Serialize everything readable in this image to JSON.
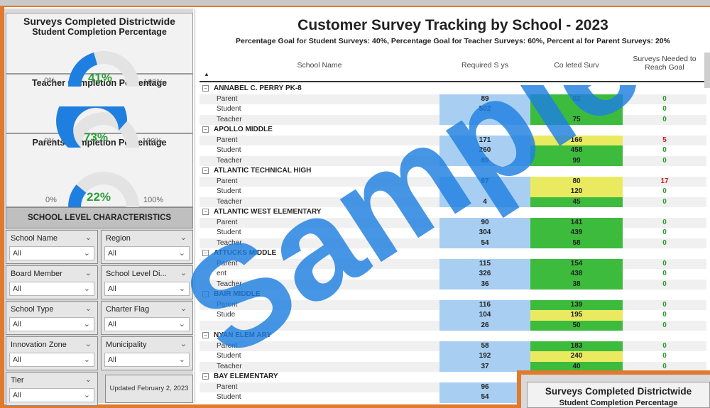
{
  "left_panel": {
    "title": "Surveys Completed Districtwide",
    "gauges": [
      {
        "label": "Student Completion Percentage",
        "value": 0.41,
        "pct_text": "41%",
        "min": "0%",
        "max": "100%"
      },
      {
        "label": "Teacher Completion Percentage",
        "value": 0.73,
        "pct_text": "73%",
        "min": "0%",
        "max": "100%"
      },
      {
        "label": "Parents Completion Percentage",
        "value": 0.22,
        "pct_text": "22%",
        "min": "0%",
        "max": "100%"
      }
    ],
    "section_header": "SCHOOL LEVEL CHARACTERISTICS",
    "filters": [
      {
        "label": "School Name",
        "value": "All"
      },
      {
        "label": "Region",
        "value": "All"
      },
      {
        "label": "Board Member",
        "value": "All"
      },
      {
        "label": "School Level Di...",
        "value": "All"
      },
      {
        "label": "School Type",
        "value": "All"
      },
      {
        "label": "Charter Flag",
        "value": "All"
      },
      {
        "label": "Innovation Zone",
        "value": "All"
      },
      {
        "label": "Municipality",
        "value": "All"
      },
      {
        "label": "Tier",
        "value": "All"
      }
    ],
    "updated": "Updated February 2, 2023"
  },
  "main": {
    "title": "Customer Survey Tracking by School - 2023",
    "subtitle": "Percentage Goal for Student Surveys: 40%, Percentage Goal for Teacher Surveys: 60%, Percent    al for Parent Surveys: 20%",
    "columns": [
      "School Name",
      "Required S      ys",
      "Co   leted Surv",
      "Surveys Needed to Reach Goal"
    ],
    "rows": [
      {
        "type": "group",
        "name": "ANNABEL C. PERRY PK-8"
      },
      {
        "type": "sub",
        "name": "Parent",
        "req": "89",
        "comp": "02",
        "comp_color": "green",
        "need": "0",
        "need_color": "g"
      },
      {
        "type": "sub",
        "name": "Student",
        "req": "502",
        "comp": "",
        "comp_color": "green",
        "need": "0",
        "need_color": "g"
      },
      {
        "type": "sub",
        "name": "Teacher",
        "req": "",
        "comp": "75",
        "comp_color": "green",
        "need": "0",
        "need_color": "g"
      },
      {
        "type": "group",
        "name": "APOLLO MIDDLE"
      },
      {
        "type": "sub",
        "name": "Parent",
        "req": "171",
        "comp": "166",
        "comp_color": "yellow",
        "need": "5",
        "need_color": "r"
      },
      {
        "type": "sub",
        "name": "Student",
        "req": "260",
        "comp": "458",
        "comp_color": "green",
        "need": "0",
        "need_color": "g"
      },
      {
        "type": "sub",
        "name": "Teacher",
        "req": "89",
        "comp": "99",
        "comp_color": "green",
        "need": "0",
        "need_color": "g"
      },
      {
        "type": "group",
        "name": "ATLANTIC TECHNICAL HIGH"
      },
      {
        "type": "sub",
        "name": "Parent",
        "req": "97",
        "comp": "80",
        "comp_color": "yellow",
        "need": "17",
        "need_color": "r"
      },
      {
        "type": "sub",
        "name": "Student",
        "req": "",
        "comp": "120",
        "comp_color": "yellow",
        "need": "0",
        "need_color": "g"
      },
      {
        "type": "sub",
        "name": "Teacher",
        "req": "4",
        "comp": "45",
        "comp_color": "green",
        "need": "0",
        "need_color": "g"
      },
      {
        "type": "group",
        "name": "ATLANTIC WEST ELEMENTARY"
      },
      {
        "type": "sub",
        "name": "Parent",
        "req": "90",
        "comp": "141",
        "comp_color": "green",
        "need": "0",
        "need_color": "g"
      },
      {
        "type": "sub",
        "name": "Student",
        "req": "304",
        "comp": "439",
        "comp_color": "green",
        "need": "0",
        "need_color": "g"
      },
      {
        "type": "sub",
        "name": "Teacher",
        "req": "54",
        "comp": "58",
        "comp_color": "green",
        "need": "0",
        "need_color": "g"
      },
      {
        "type": "group",
        "name": "ATTUCKS MIDDLE"
      },
      {
        "type": "sub",
        "name": "Parent",
        "req": "115",
        "comp": "154",
        "comp_color": "green",
        "need": "0",
        "need_color": "g"
      },
      {
        "type": "sub",
        "name": "   ent",
        "req": "326",
        "comp": "438",
        "comp_color": "green",
        "need": "0",
        "need_color": "g"
      },
      {
        "type": "sub",
        "name": "Teacher",
        "req": "36",
        "comp": "38",
        "comp_color": "green",
        "need": "0",
        "need_color": "g"
      },
      {
        "type": "group",
        "name": "BAIR MIDDLE"
      },
      {
        "type": "sub",
        "name": "Parent",
        "req": "116",
        "comp": "139",
        "comp_color": "green",
        "need": "0",
        "need_color": "g"
      },
      {
        "type": "sub",
        "name": "Stude",
        "req": "104",
        "comp": "195",
        "comp_color": "yellow",
        "need": "0",
        "need_color": "g"
      },
      {
        "type": "sub",
        "name": "",
        "req": "26",
        "comp": "50",
        "comp_color": "green",
        "need": "0",
        "need_color": "g"
      },
      {
        "type": "group",
        "name": "  NYAN ELEM    ARY"
      },
      {
        "type": "sub",
        "name": "Parent",
        "req": "58",
        "comp": "183",
        "comp_color": "green",
        "need": "0",
        "need_color": "g"
      },
      {
        "type": "sub",
        "name": "Student",
        "req": "192",
        "comp": "240",
        "comp_color": "yellow",
        "need": "0",
        "need_color": "g"
      },
      {
        "type": "sub",
        "name": "Teacher",
        "req": "37",
        "comp": "40",
        "comp_color": "green",
        "need": "0",
        "need_color": "g"
      },
      {
        "type": "group",
        "name": "BAY   ELEMENTARY"
      },
      {
        "type": "sub",
        "name": "Parent",
        "req": "96",
        "comp": "",
        "comp_color": "none",
        "need": "",
        "need_color": "g"
      },
      {
        "type": "sub",
        "name": "Student",
        "req": "54",
        "comp": "",
        "comp_color": "none",
        "need": "",
        "need_color": "g"
      }
    ]
  },
  "watermark": "Sample",
  "thumbnail": {
    "title": "Surveys Completed Districtwide",
    "subtitle": "Student Completion Percentage"
  },
  "colors": {
    "frame": "#e07a2e",
    "gauge_fill": "#1f7fe0",
    "gauge_track": "#e3e3e3",
    "required_bg": "#a8cff2",
    "met_goal": "#3dbb3d",
    "near_goal": "#e9ea60",
    "watermark": "#1f7fe0"
  }
}
